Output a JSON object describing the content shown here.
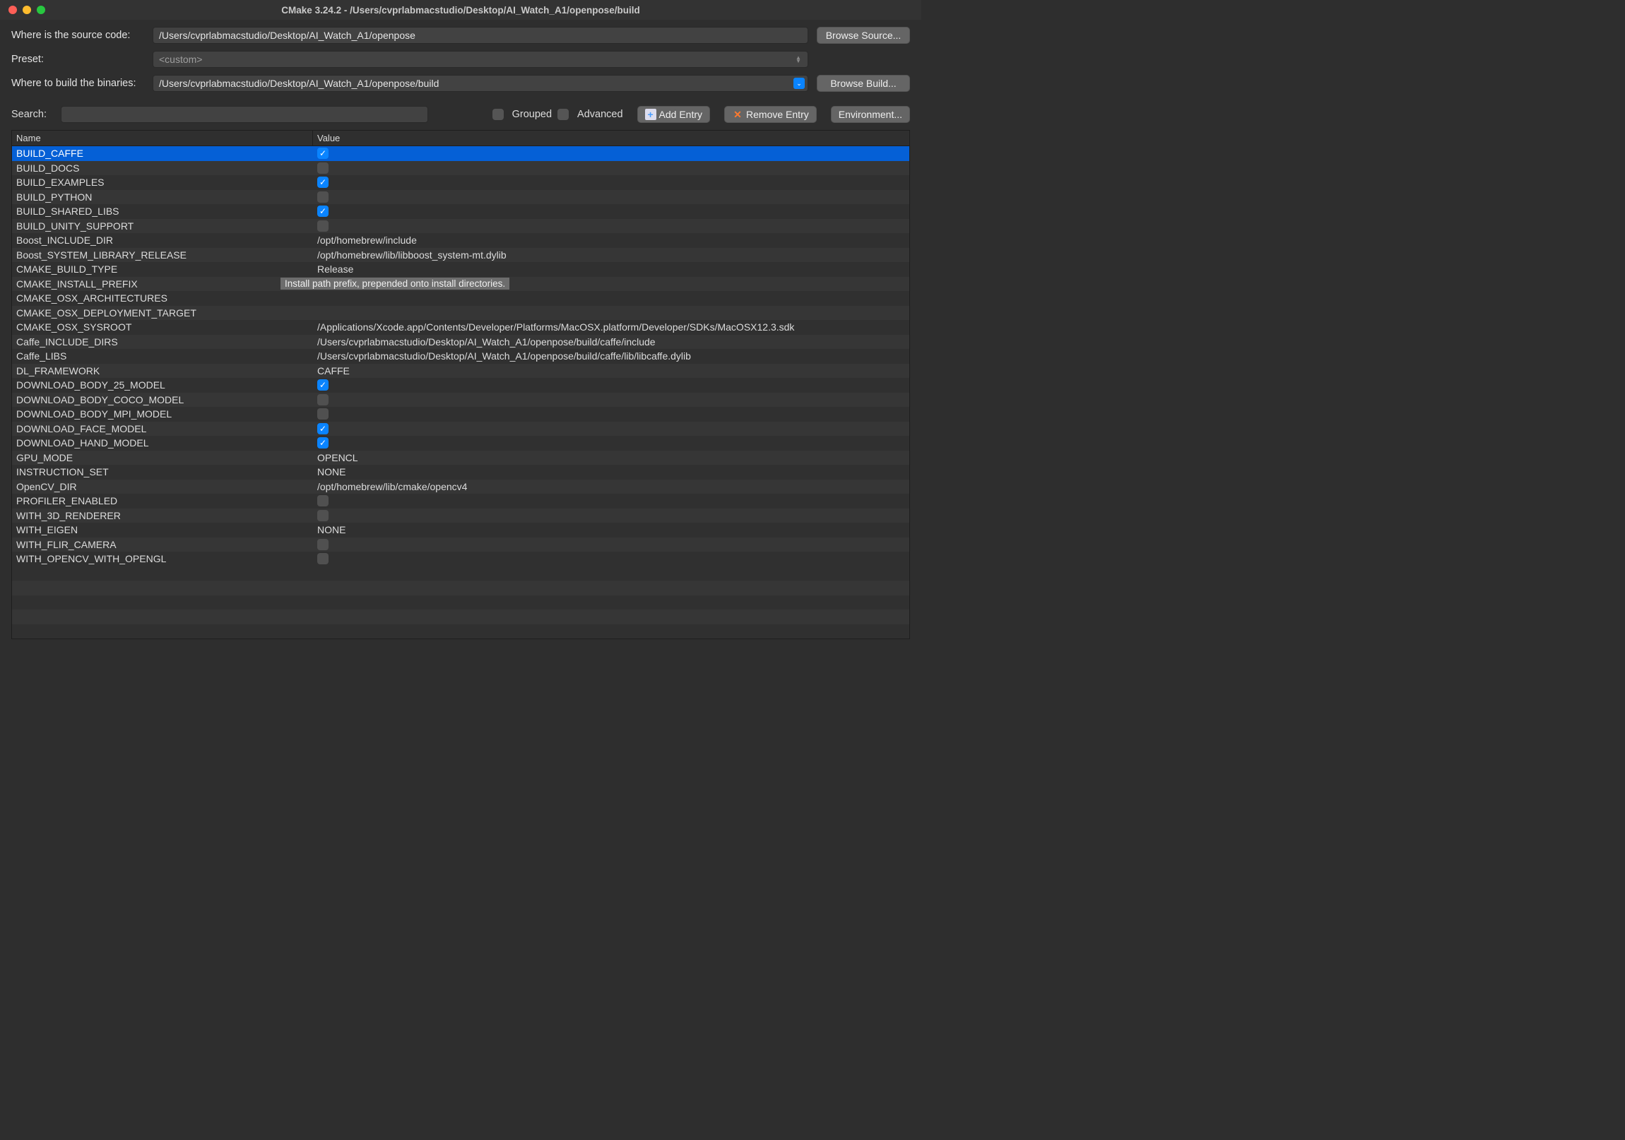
{
  "window": {
    "title": "CMake 3.24.2 - /Users/cvprlabmacstudio/Desktop/AI_Watch_A1/openpose/build"
  },
  "form": {
    "source_label": "Where is the source code:",
    "source_path": "/Users/cvprlabmacstudio/Desktop/AI_Watch_A1/openpose",
    "browse_source": "Browse Source...",
    "preset_label": "Preset:",
    "preset_value": "<custom>",
    "build_label": "Where to build the binaries:",
    "build_path": "/Users/cvprlabmacstudio/Desktop/AI_Watch_A1/openpose/build",
    "browse_build": "Browse Build..."
  },
  "toolbar": {
    "search_label": "Search:",
    "grouped_label": "Grouped",
    "advanced_label": "Advanced",
    "add_entry": "Add Entry",
    "remove_entry": "Remove Entry",
    "environment": "Environment..."
  },
  "table": {
    "headers": {
      "name": "Name",
      "value": "Value"
    },
    "tooltip": "Install path prefix, prepended onto install directories.",
    "rows": [
      {
        "name": "BUILD_CAFFE",
        "type": "bool",
        "value": true,
        "selected": true
      },
      {
        "name": "BUILD_DOCS",
        "type": "bool",
        "value": false
      },
      {
        "name": "BUILD_EXAMPLES",
        "type": "bool",
        "value": true
      },
      {
        "name": "BUILD_PYTHON",
        "type": "bool",
        "value": false
      },
      {
        "name": "BUILD_SHARED_LIBS",
        "type": "bool",
        "value": true
      },
      {
        "name": "BUILD_UNITY_SUPPORT",
        "type": "bool",
        "value": false
      },
      {
        "name": "Boost_INCLUDE_DIR",
        "type": "text",
        "value": "/opt/homebrew/include"
      },
      {
        "name": "Boost_SYSTEM_LIBRARY_RELEASE",
        "type": "text",
        "value": "/opt/homebrew/lib/libboost_system-mt.dylib"
      },
      {
        "name": "CMAKE_BUILD_TYPE",
        "type": "text",
        "value": "Release"
      },
      {
        "name": "CMAKE_INSTALL_PREFIX",
        "type": "tooltip",
        "value": ""
      },
      {
        "name": "CMAKE_OSX_ARCHITECTURES",
        "type": "text",
        "value": ""
      },
      {
        "name": "CMAKE_OSX_DEPLOYMENT_TARGET",
        "type": "text",
        "value": ""
      },
      {
        "name": "CMAKE_OSX_SYSROOT",
        "type": "text",
        "value": "/Applications/Xcode.app/Contents/Developer/Platforms/MacOSX.platform/Developer/SDKs/MacOSX12.3.sdk"
      },
      {
        "name": "Caffe_INCLUDE_DIRS",
        "type": "text",
        "value": "/Users/cvprlabmacstudio/Desktop/AI_Watch_A1/openpose/build/caffe/include"
      },
      {
        "name": "Caffe_LIBS",
        "type": "text",
        "value": "/Users/cvprlabmacstudio/Desktop/AI_Watch_A1/openpose/build/caffe/lib/libcaffe.dylib"
      },
      {
        "name": "DL_FRAMEWORK",
        "type": "text",
        "value": "CAFFE"
      },
      {
        "name": "DOWNLOAD_BODY_25_MODEL",
        "type": "bool",
        "value": true
      },
      {
        "name": "DOWNLOAD_BODY_COCO_MODEL",
        "type": "bool",
        "value": false
      },
      {
        "name": "DOWNLOAD_BODY_MPI_MODEL",
        "type": "bool",
        "value": false
      },
      {
        "name": "DOWNLOAD_FACE_MODEL",
        "type": "bool",
        "value": true
      },
      {
        "name": "DOWNLOAD_HAND_MODEL",
        "type": "bool",
        "value": true
      },
      {
        "name": "GPU_MODE",
        "type": "text",
        "value": "OPENCL"
      },
      {
        "name": "INSTRUCTION_SET",
        "type": "text",
        "value": "NONE"
      },
      {
        "name": "OpenCV_DIR",
        "type": "text",
        "value": "/opt/homebrew/lib/cmake/opencv4"
      },
      {
        "name": "PROFILER_ENABLED",
        "type": "bool",
        "value": false
      },
      {
        "name": "WITH_3D_RENDERER",
        "type": "bool",
        "value": false
      },
      {
        "name": "WITH_EIGEN",
        "type": "text",
        "value": "NONE"
      },
      {
        "name": "WITH_FLIR_CAMERA",
        "type": "bool",
        "value": false
      },
      {
        "name": "WITH_OPENCV_WITH_OPENGL",
        "type": "bool",
        "value": false
      }
    ]
  }
}
